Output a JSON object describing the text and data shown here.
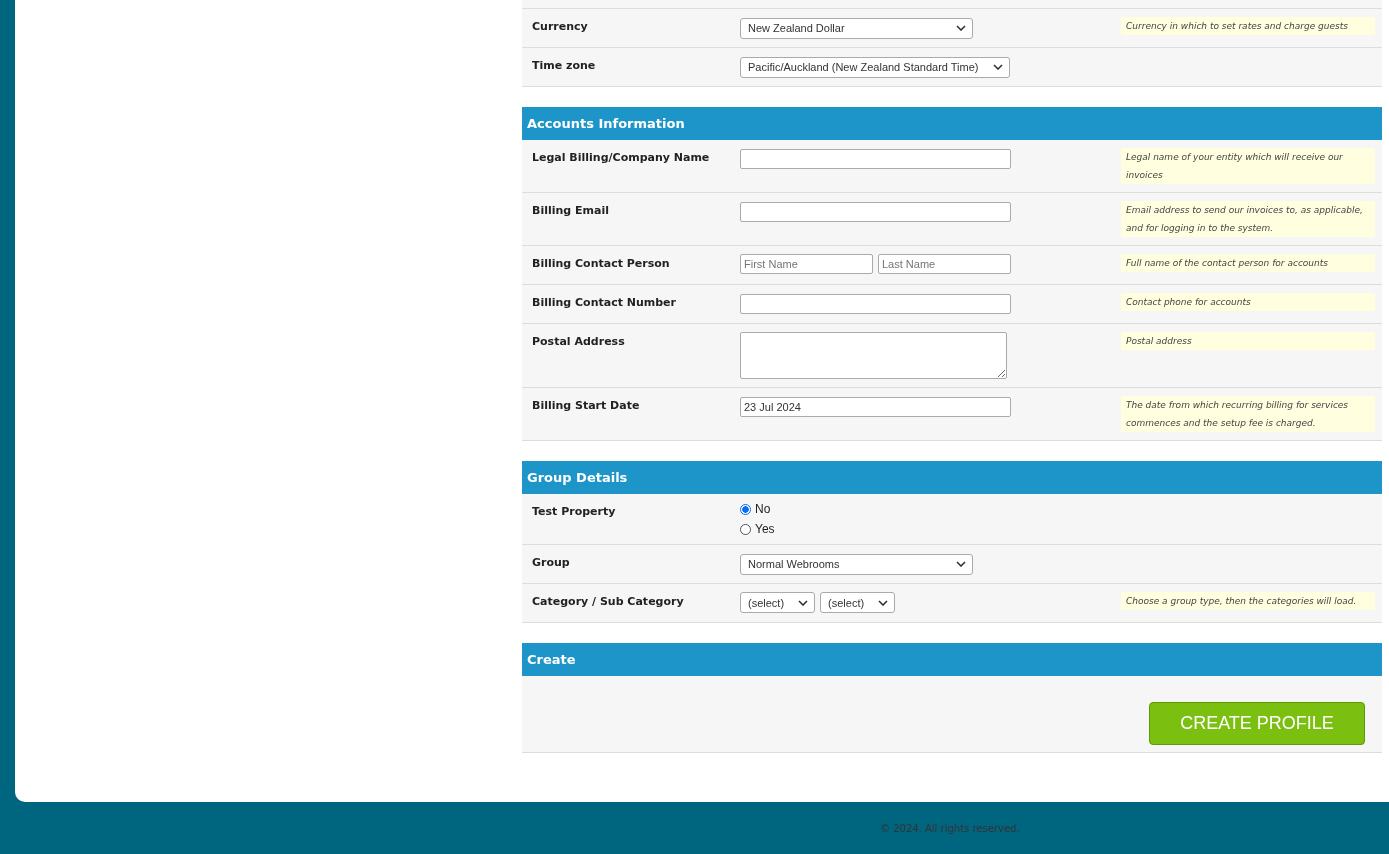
{
  "sections": [
    {
      "rows": [
        {
          "kind": "select",
          "label": "Currency",
          "value": "New Zealand Dollar",
          "hint": "Currency in which to set rates and charge guests"
        },
        {
          "kind": "select",
          "label": "Time zone",
          "value": "Pacific/Auckland (New Zealand Standard Time)"
        }
      ]
    },
    {
      "title": "Accounts Information",
      "rows": [
        {
          "kind": "text",
          "label": "Legal Billing/Company Name",
          "hint": "Legal name of your entity which will receive our invoices"
        },
        {
          "kind": "text",
          "label": "Billing Email",
          "hint": "Email address to send our invoices to, as applicable, and for logging in to the system."
        },
        {
          "kind": "name-pair",
          "label": "Billing Contact Person",
          "placeholders": [
            "First Name",
            "Last Name"
          ],
          "hint": "Full name of the contact person for accounts"
        },
        {
          "kind": "text",
          "label": "Billing Contact Number",
          "hint": "Contact phone for accounts"
        },
        {
          "kind": "textarea",
          "label": "Postal Address",
          "hint": "Postal address"
        },
        {
          "kind": "text",
          "label": "Billing Start Date",
          "value": "23 Jul 2024",
          "hint": "The date from which recurring billing for services commences and the setup fee is charged."
        }
      ]
    },
    {
      "title": "Group Details",
      "rows": [
        {
          "kind": "radio",
          "label": "Test Property",
          "options": [
            {
              "label": "No",
              "selected": true
            },
            {
              "label": "Yes",
              "selected": false
            }
          ]
        },
        {
          "kind": "select",
          "label": "Group",
          "value": "Normal Webrooms"
        },
        {
          "kind": "select-pair",
          "label": "Category / Sub Category",
          "values": [
            "(select)",
            "(select)"
          ],
          "hint": "Choose a group type, then the categories will load."
        }
      ]
    },
    {
      "title": "Create",
      "rows": [
        {
          "kind": "button",
          "label": "CREATE PROFILE"
        }
      ]
    }
  ],
  "footer": "© 2024. All rights reserved."
}
